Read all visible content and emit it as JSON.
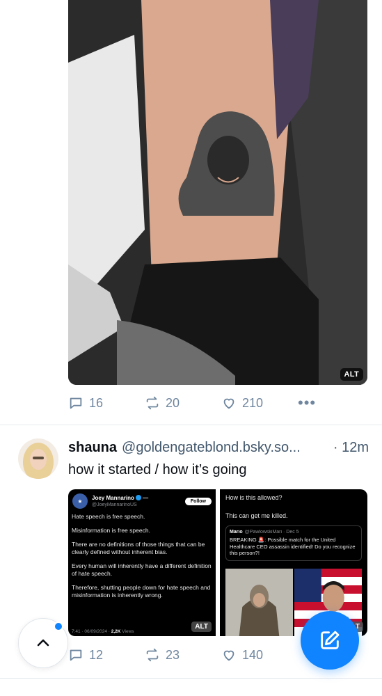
{
  "post1": {
    "image_alt_badge": "ALT",
    "actions": {
      "replies": "16",
      "reposts": "20",
      "likes": "210"
    }
  },
  "post2": {
    "display_name": "shauna",
    "handle": "@goldengateblond.bsky.so...",
    "timestamp": "· 12m",
    "text": "how it started / how it’s going",
    "left_image": {
      "author_name": "Joey Mannarino",
      "author_suffix": "—",
      "author_handle": "@JoeyMannarinoUS",
      "follow_label": "Follow",
      "lines": [
        "Hate speech is free speech.",
        "Misinformation is free speech.",
        "There are no definitions of those things that can be clearly defined without inherent bias.",
        "Every human will inherently have a different definition of hate speech.",
        "Therefore, shutting people down for hate speech and misinformation is inherently wrong."
      ],
      "footer_time": "7:41 · 06/09/2024 ·",
      "footer_views": "2,2K",
      "footer_views_label": "Views",
      "alt_badge": "ALT"
    },
    "right_image": {
      "line1": "How is this allowed?",
      "line2": "This can get me killed.",
      "quote_name": "Mario",
      "quote_handle": "@PawlowskiMari · Dec 5",
      "quote_text": "BREAKING 🚨: Possible match for the United Healthcare CEO assassin identified! Do you recognize this person?!",
      "alt_badge": "ALT"
    },
    "actions": {
      "replies": "12",
      "reposts": "23",
      "likes": "140"
    }
  },
  "colors": {
    "accent": "#1083fe",
    "action_gray": "#6f869f",
    "divider": "#e5e9ee"
  },
  "icons": [
    "reply-icon",
    "repost-icon",
    "like-icon",
    "more-icon",
    "chevron-up-icon",
    "compose-icon"
  ]
}
